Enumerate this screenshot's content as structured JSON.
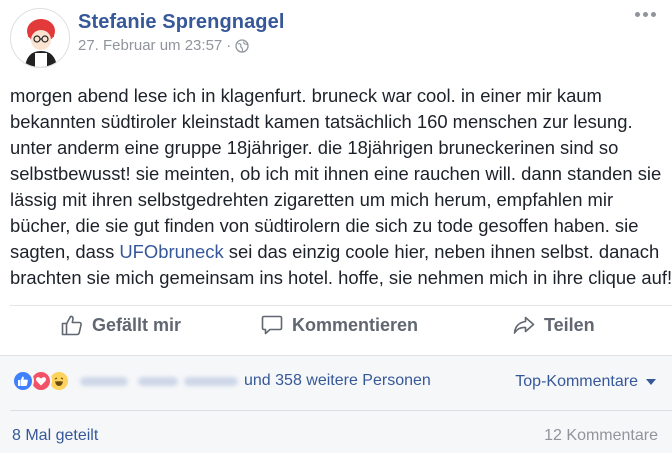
{
  "post": {
    "author": "Stefanie Sprengnagel",
    "timestamp": "27. Februar um 23:57",
    "separator": "·",
    "privacy_icon": "globe-icon",
    "text_lines": {
      "l1": "morgen abend lese ich in klagenfurt. bruneck war cool. in einer mir kaum",
      "l2": "bekannten südtiroler kleinstadt kamen tatsächlich 160 menschen zur lesung.",
      "l3": "unter anderm eine gruppe 18jähriger. die 18jährigen bruneckerinen sind so",
      "l4": "selbstbewusst! sie meinten, ob ich mit ihnen eine rauchen will. dann standen sie",
      "l5": "lässig mit ihren selbstgedrehten zigaretten um mich herum, empfahlen mir",
      "l6": "bücher, die sie gut finden von südtirolern die sich zu tode gesoffen haben. sie",
      "l7_before": "sagten, dass ",
      "l7_link": "UFObruneck",
      "l7_after": " sei das einzig coole hier, neben ihnen selbst. danach",
      "l8": "brachten sie mich gemeinsam ins hotel. hoffe, sie nehmen mich in ihre clique auf!"
    }
  },
  "actions": {
    "like": "Gefällt mir",
    "comment": "Kommentieren",
    "share": "Teilen"
  },
  "reactions": {
    "icons": [
      "like-icon",
      "love-icon",
      "haha-icon"
    ],
    "others_text": "und 358 weitere Personen",
    "top_comments": "Top-Kommentare"
  },
  "footer": {
    "shares": "8 Mal geteilt",
    "comments": "12 Kommentare"
  },
  "colors": {
    "link": "#365899",
    "meta": "#90949c",
    "action": "#606770",
    "like": "#4080ff",
    "love": "#f25268",
    "haha": "#fcd35c"
  }
}
